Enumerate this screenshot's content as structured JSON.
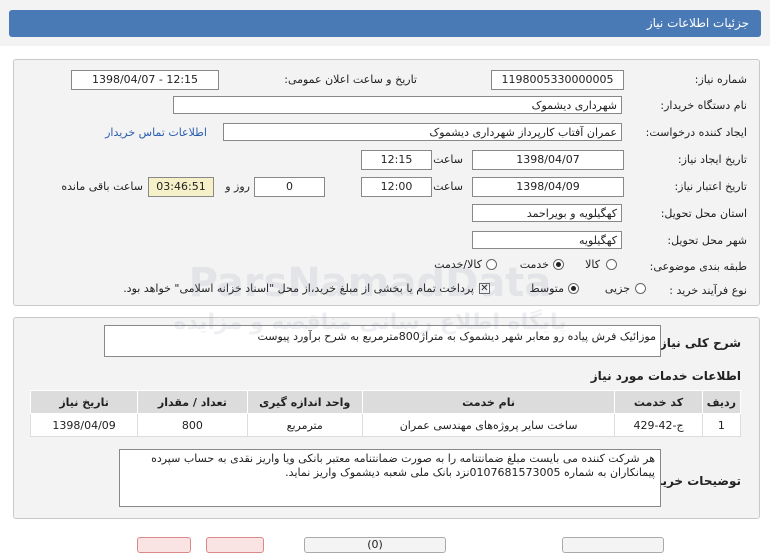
{
  "header": {
    "title": "جزئیات اطلاعات نیاز"
  },
  "form": {
    "need_number_label": "شماره نیاز:",
    "need_number": "1198005330000005",
    "announce_label": "تاریخ و ساعت اعلان عمومی:",
    "announce_value": "1398/04/07 - 12:15",
    "buyer_org_label": "نام دستگاه خریدار:",
    "buyer_org": "شهرداری دیشموک",
    "requester_label": "ایجاد کننده درخواست:",
    "requester": "عمران آفتاب کارپرداز شهرداری دیشموک",
    "contact_link": "اطلاعات تماس خریدار",
    "created_label": "تاریخ ایجاد نیاز:",
    "created_date": "1398/04/07",
    "time_label": "ساعت",
    "created_time": "12:15",
    "validity_label": "تاریخ اعتبار نیاز:",
    "validity_date": "1398/04/09",
    "validity_time": "12:00",
    "days_value": "0",
    "days_label": "روز و",
    "remaining_time": "03:46:51",
    "remaining_label": "ساعت باقی مانده",
    "province_label": "استان محل تحویل:",
    "province": "کهگیلویه و بویراحمد",
    "city_label": "شهر محل تحویل:",
    "city": "کهگیلویه",
    "category_label": "طبقه بندی موضوعی:",
    "category_options": [
      "کالا",
      "خدمت",
      "کالا/خدمت"
    ],
    "purchase_label": "نوع فرآیند خرید :",
    "purchase_options": [
      "جزیی",
      "متوسط"
    ],
    "payment_note": "پرداخت تمام یا بخشی از مبلغ خرید،از محل \"اسناد خزانه اسلامی\" خواهد بود."
  },
  "description": {
    "label": "شرح کلی نیاز:",
    "text": "موزائیک فرش پیاده رو معابر شهر دیشموک به متراژ800مترمربع به شرح برآورد پیوست"
  },
  "services": {
    "title": "اطلاعات خدمات مورد نیاز",
    "columns": [
      "ردیف",
      "کد خدمت",
      "نام خدمت",
      "واحد اندازه گیری",
      "تعداد / مقدار",
      "تاریخ نیاز"
    ],
    "rows": [
      [
        "1",
        "ج-42-429",
        "ساخت سایر پروژه‌های مهندسی عمران",
        "مترمربع",
        "800",
        "1398/04/09"
      ]
    ]
  },
  "buyer_notes": {
    "label": "توضیحات خریدار:",
    "text": "هر شرکت کننده می بایست مبلغ ضمانتنامه را به صورت ضمانتنامه معتبر بانکی ویا واریز نقدی به حساب سپرده پیمانکاران به شماره 0107681573005نزد بانک ملی شعبه دیشموک واریز نماید."
  },
  "watermark": {
    "line1": "ParsNamadData",
    "line2": "پایگاه اطلاع رسانی مناقصه و مزایده"
  },
  "bottom": {
    "center_label": "(0)"
  }
}
